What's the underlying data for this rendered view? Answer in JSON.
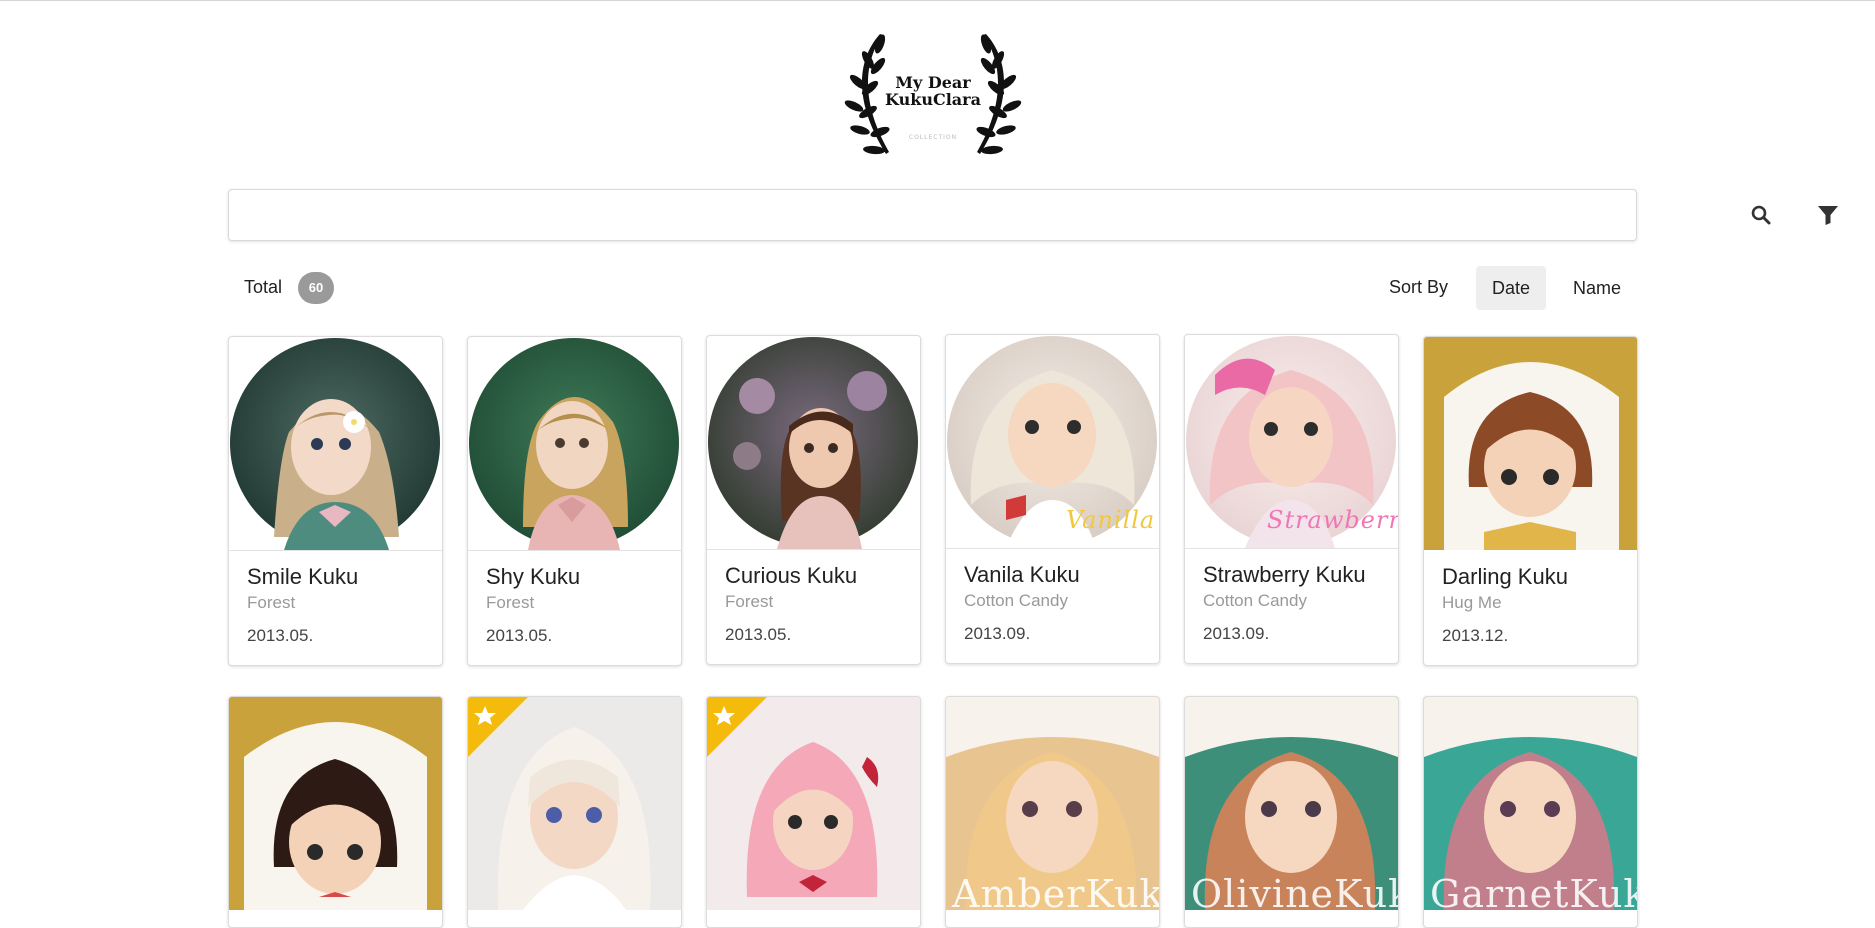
{
  "logo": {
    "line1": "My Dear",
    "line2": "KukuClara",
    "line3": "COLLECTION"
  },
  "search": {
    "placeholder": ""
  },
  "summary": {
    "total_label": "Total",
    "total_count": "60"
  },
  "sort": {
    "label": "Sort By",
    "date_label": "Date",
    "name_label": "Name",
    "active": "Date"
  },
  "cards_row1": [
    {
      "name": "Smile Kuku",
      "series": "Forest",
      "date": "2013.05."
    },
    {
      "name": "Shy Kuku",
      "series": "Forest",
      "date": "2013.05."
    },
    {
      "name": "Curious Kuku",
      "series": "Forest",
      "date": "2013.05."
    },
    {
      "name": "Vanila Kuku",
      "series": "Cotton Candy",
      "date": "2013.09.",
      "image_text": "Vanilla"
    },
    {
      "name": "Strawberry Kuku",
      "series": "Cotton Candy",
      "date": "2013.09.",
      "image_text": "Strawberry"
    },
    {
      "name": "Darling Kuku",
      "series": "Hug Me",
      "date": "2013.12."
    }
  ],
  "cards_row2": [
    {
      "featured": false
    },
    {
      "featured": true
    },
    {
      "featured": true
    },
    {
      "image_text": "AmberKuku"
    },
    {
      "image_text": "OlivineKuku"
    },
    {
      "image_text": "GarnetKuku"
    }
  ],
  "colors": {
    "badge": "#9a9a9a",
    "star_ribbon": "#f5bb0c",
    "sort_active_bg": "#eeeeee"
  },
  "icons": {
    "search": "search-icon",
    "filter": "filter-icon",
    "star": "star-icon"
  }
}
